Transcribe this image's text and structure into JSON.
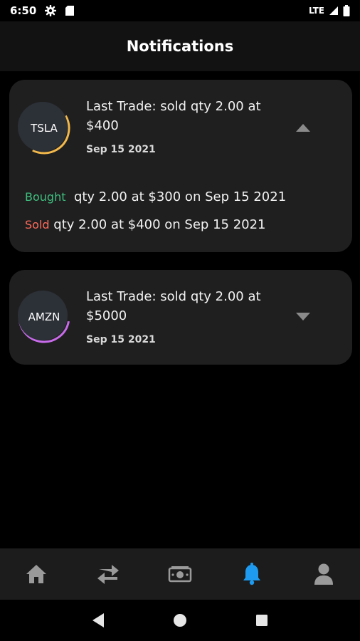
{
  "status_bar": {
    "time": "6:50",
    "network": "LTE",
    "icons": [
      "gear-icon",
      "sd-card-icon",
      "signal-icon",
      "battery-icon"
    ]
  },
  "header": {
    "title": "Notifications"
  },
  "notifications": [
    {
      "symbol": "TSLA",
      "ring_color": "#f2b84b",
      "title": "Last Trade: sold qty 2.00 at $400",
      "date": "Sep 15 2021",
      "expanded": true,
      "toggle_icon": "chevron-up-icon",
      "history": [
        {
          "tag": "Bought",
          "text": "qty 2.00 at $300 on Sep 15 2021",
          "color": "#3fbf7f"
        },
        {
          "tag": "Sold",
          "text": "qty 2.00 at $400 on Sep 15 2021",
          "color": "#ff6b5b"
        }
      ]
    },
    {
      "symbol": "AMZN",
      "ring_color": "#c86bea",
      "title": "Last Trade: sold qty 2.00 at $5000",
      "date": "Sep 15 2021",
      "expanded": false,
      "toggle_icon": "chevron-down-icon"
    }
  ],
  "bottom_nav": {
    "items": [
      "home-icon",
      "transfer-icon",
      "cash-icon",
      "bell-icon",
      "user-icon"
    ],
    "active": "bell-icon",
    "active_color": "#1e9bf0",
    "inactive_color": "#9a9a9a"
  },
  "system_nav": {
    "items": [
      "back-icon",
      "home-circle-icon",
      "recents-icon"
    ]
  }
}
